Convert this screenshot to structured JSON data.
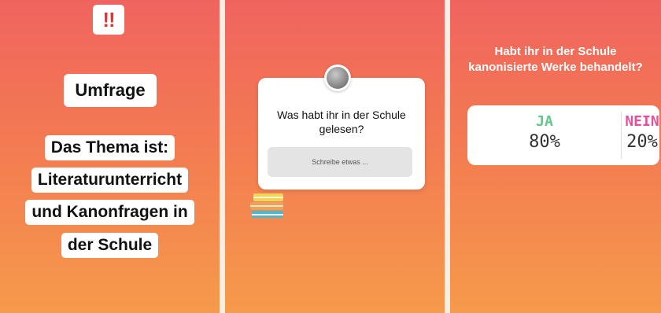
{
  "panel1": {
    "alert_badge": "!!",
    "title": "Umfrage",
    "topic_lines": [
      "Das Thema ist:",
      "Literaturunterricht",
      "und Kanonfragen in",
      "der Schule"
    ]
  },
  "panel2": {
    "question": "Was habt ihr in der Schule gelesen?",
    "input_placeholder": "Schreibe etwas ..."
  },
  "panel3": {
    "question": "Habt ihr in der Schule kanonisierte Werke behandelt?",
    "options": [
      {
        "label": "JA",
        "percent": "80%",
        "value": 80,
        "color": "#5fc88a"
      },
      {
        "label": "NEIN",
        "percent": "20%",
        "value": 20,
        "color": "#e64f9a"
      }
    ]
  },
  "colors": {
    "gradient_top": "#f0645f",
    "gradient_bottom": "#f69a4b",
    "alert_red": "#e8322b"
  }
}
